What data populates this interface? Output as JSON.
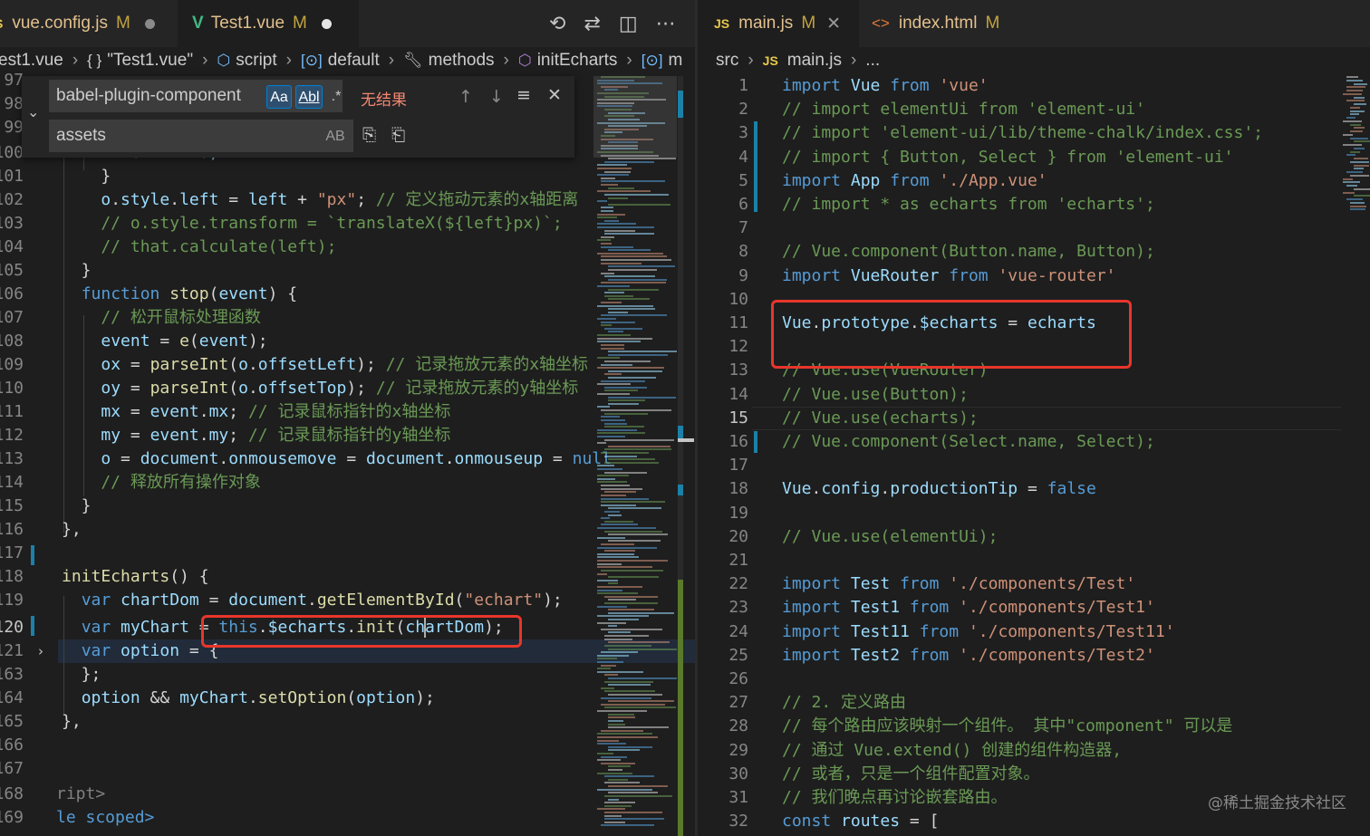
{
  "left_editor": {
    "tabs": [
      {
        "label": "vue.config.js",
        "modified": "M",
        "icon": "js-icon",
        "prefix": "S"
      },
      {
        "label": "Test1.vue",
        "modified": "M",
        "icon": "vue-icon"
      }
    ],
    "actions": [
      "history-icon",
      "source-control-icon",
      "split-editor-icon",
      "more-icon"
    ],
    "breadcrumb": [
      {
        "label": "est1.vue",
        "icon": ""
      },
      {
        "label": "\"Test1.vue\"",
        "icon": "{ }"
      },
      {
        "label": "script",
        "icon": "cube"
      },
      {
        "label": "default",
        "icon": "[⊙]"
      },
      {
        "label": "methods",
        "icon": "wrench"
      },
      {
        "label": "initEcharts",
        "icon": "cube"
      },
      {
        "label": "m",
        "icon": "[⊙]"
      }
    ],
    "find_widget": {
      "search_value": "babel-plugin-component",
      "replace_value": "assets",
      "option_match_case": "Aa",
      "option_whole_word": "Abl",
      "option_regex": ".*",
      "result": "无结果",
      "preserve_case": "AB"
    },
    "lines": [
      {
        "num": "97",
        "text": ""
      },
      {
        "num": "98",
        "text": ""
      },
      {
        "num": "99",
        "text": ""
      },
      {
        "num": "100",
        "text": "      left = 10;"
      },
      {
        "num": "101",
        "text": "    }"
      },
      {
        "num": "102",
        "text": "    o.style.left = left + \"px\"; // 定义拖动元素的x轴距离"
      },
      {
        "num": "103",
        "text": "    // o.style.transform = `translateX(${left}px)`;"
      },
      {
        "num": "104",
        "text": "    // that.calculate(left);"
      },
      {
        "num": "105",
        "text": "  }"
      },
      {
        "num": "106",
        "text": "  function stop(event) {"
      },
      {
        "num": "107",
        "text": "    // 松开鼠标处理函数"
      },
      {
        "num": "108",
        "text": "    event = e(event);"
      },
      {
        "num": "109",
        "text": "    ox = parseInt(o.offsetLeft); // 记录拖放元素的x轴坐标"
      },
      {
        "num": "110",
        "text": "    oy = parseInt(o.offsetTop); // 记录拖放元素的y轴坐标"
      },
      {
        "num": "111",
        "text": "    mx = event.mx; // 记录鼠标指针的x轴坐标"
      },
      {
        "num": "112",
        "text": "    my = event.my; // 记录鼠标指针的y轴坐标"
      },
      {
        "num": "113",
        "text": "    o = document.onmousemove = document.onmouseup = null"
      },
      {
        "num": "114",
        "text": "    // 释放所有操作对象"
      },
      {
        "num": "115",
        "text": "  }"
      },
      {
        "num": "116",
        "text": "},"
      },
      {
        "num": "117",
        "text": ""
      },
      {
        "num": "118",
        "text": "initEcharts() {"
      },
      {
        "num": "119",
        "text": "  var chartDom = document.getElementById(\"echart\");"
      },
      {
        "num": "120",
        "text": "  var myChart = this.$echarts.init(chartDom);"
      },
      {
        "num": "121",
        "text": "  var option = {"
      },
      {
        "num": "163",
        "text": "  };"
      },
      {
        "num": "164",
        "text": "  option && myChart.setOption(option);"
      },
      {
        "num": "165",
        "text": "},"
      },
      {
        "num": "166",
        "text": ""
      },
      {
        "num": "167",
        "text": ""
      },
      {
        "num": "168",
        "text": "ript>"
      },
      {
        "num": "169",
        "text": "le scoped>"
      }
    ]
  },
  "right_editor": {
    "tabs": [
      {
        "label": "main.js",
        "modified": "M",
        "icon": "JS"
      },
      {
        "label": "index.html",
        "modified": "M",
        "icon": "html-icon"
      }
    ],
    "breadcrumb": [
      {
        "label": "src"
      },
      {
        "label": "main.js",
        "icon": "JS"
      },
      {
        "label": "..."
      }
    ],
    "lines": [
      {
        "num": "1",
        "text": "import Vue from 'vue'"
      },
      {
        "num": "2",
        "text": "// import elementUi from 'element-ui'"
      },
      {
        "num": "3",
        "text": "// import 'element-ui/lib/theme-chalk/index.css';"
      },
      {
        "num": "4",
        "text": "// import { Button, Select } from 'element-ui'"
      },
      {
        "num": "5",
        "text": "import App from './App.vue'"
      },
      {
        "num": "6",
        "text": "// import * as echarts from 'echarts';"
      },
      {
        "num": "7",
        "text": ""
      },
      {
        "num": "8",
        "text": "// Vue.component(Button.name, Button);"
      },
      {
        "num": "9",
        "text": "import VueRouter from 'vue-router'"
      },
      {
        "num": "10",
        "text": ""
      },
      {
        "num": "11",
        "text": "Vue.prototype.$echarts = echarts"
      },
      {
        "num": "12",
        "text": ""
      },
      {
        "num": "13",
        "text": "// Vue.use(VueRouter)"
      },
      {
        "num": "14",
        "text": "// Vue.use(Button);"
      },
      {
        "num": "15",
        "text": "// Vue.use(echarts);"
      },
      {
        "num": "16",
        "text": "// Vue.component(Select.name, Select);"
      },
      {
        "num": "17",
        "text": ""
      },
      {
        "num": "18",
        "text": "Vue.config.productionTip = false"
      },
      {
        "num": "19",
        "text": ""
      },
      {
        "num": "20",
        "text": "// Vue.use(elementUi);"
      },
      {
        "num": "21",
        "text": ""
      },
      {
        "num": "22",
        "text": "import Test from './components/Test'"
      },
      {
        "num": "23",
        "text": "import Test1 from './components/Test1'"
      },
      {
        "num": "24",
        "text": "import Test11 from './components/Test11'"
      },
      {
        "num": "25",
        "text": "import Test2 from './components/Test2'"
      },
      {
        "num": "26",
        "text": ""
      },
      {
        "num": "27",
        "text": "// 2. 定义路由"
      },
      {
        "num": "28",
        "text": "// 每个路由应该映射一个组件。 其中\"component\" 可以是"
      },
      {
        "num": "29",
        "text": "// 通过 Vue.extend() 创建的组件构造器,"
      },
      {
        "num": "30",
        "text": "// 或者，只是一个组件配置对象。"
      },
      {
        "num": "31",
        "text": "// 我们晚点再讨论嵌套路由。"
      },
      {
        "num": "32",
        "text": "const routes = ["
      }
    ]
  },
  "watermark": "@稀土掘金技术社区",
  "colors": {
    "keyword": "#569cd6",
    "function": "#dcdcaa",
    "variable": "#9cdcfe",
    "string": "#ce9178",
    "comment": "#6a9955",
    "highlight_box": "#e8362c"
  }
}
